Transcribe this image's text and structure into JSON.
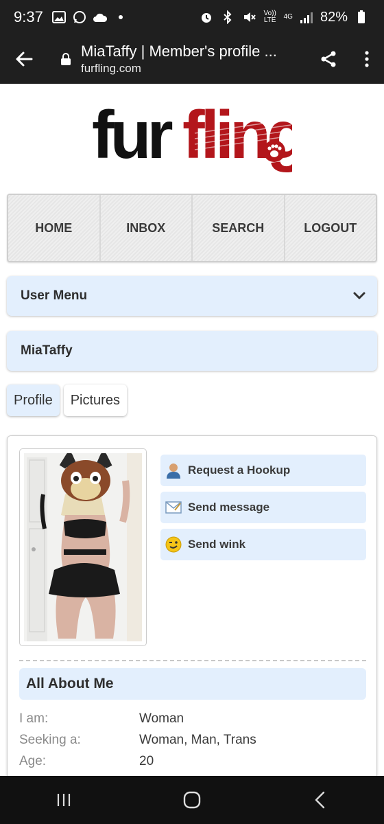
{
  "status": {
    "time": "9:37",
    "volte": "Vo)) LTE",
    "network": "4G",
    "battery": "82%",
    "left_icons": [
      "image-icon",
      "whatsapp-icon",
      "cloud-icon",
      "dot-icon"
    ],
    "right_icons": [
      "alarm-icon",
      "bluetooth-icon",
      "mute-icon",
      "volte-icon",
      "network-icon",
      "signal-icon",
      "battery-icon"
    ]
  },
  "browser": {
    "title": "MiaTaffy | Member's profile ...",
    "domain": "furfling.com"
  },
  "site": {
    "logo_part1": "fur",
    "logo_part2": "fling",
    "brand_black": "#111111",
    "brand_red": "#b3161b"
  },
  "nav": {
    "items": [
      {
        "label": "HOME"
      },
      {
        "label": "INBOX"
      },
      {
        "label": "SEARCH"
      },
      {
        "label": "LOGOUT"
      }
    ]
  },
  "user_menu": {
    "label": "User Menu"
  },
  "profile": {
    "username": "MiaTaffy",
    "tabs": [
      {
        "label": "Profile",
        "active": true
      },
      {
        "label": "Pictures",
        "active": false
      }
    ],
    "actions": [
      {
        "label": "Request a Hookup",
        "icon": "user-icon"
      },
      {
        "label": "Send message",
        "icon": "envelope-icon"
      },
      {
        "label": "Send wink",
        "icon": "wink-icon"
      }
    ],
    "section_title": "All About Me",
    "details": [
      {
        "key": "I am:",
        "value": "Woman"
      },
      {
        "key": "Seeking a:",
        "value": "Woman, Man, Trans"
      },
      {
        "key": "Age:",
        "value": "20"
      }
    ]
  },
  "accent": "#e3effd"
}
